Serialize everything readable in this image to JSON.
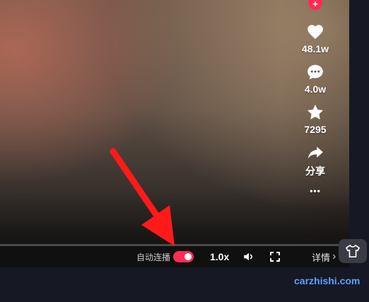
{
  "actions": {
    "follow_symbol": "+",
    "likes": "48.1w",
    "comments": "4.0w",
    "favorites": "7295",
    "share_label": "分享",
    "more_symbol": "•••"
  },
  "controls": {
    "autoplay_label": "自动连播",
    "autoplay_on": true,
    "speed_label": "1.0x",
    "details_label": "详情",
    "details_chevron": "›"
  },
  "watermark": "carzhishi.com",
  "colors": {
    "accent": "#fe2c55",
    "page_background": "#161823",
    "watermark": "#5aa0ff",
    "annotation_arrow": "#ff1a1a"
  },
  "icons": [
    "follow-plus-icon",
    "heart-icon",
    "comment-icon",
    "star-icon",
    "share-icon",
    "more-icon",
    "volume-icon",
    "fullscreen-icon",
    "tshirt-icon"
  ]
}
